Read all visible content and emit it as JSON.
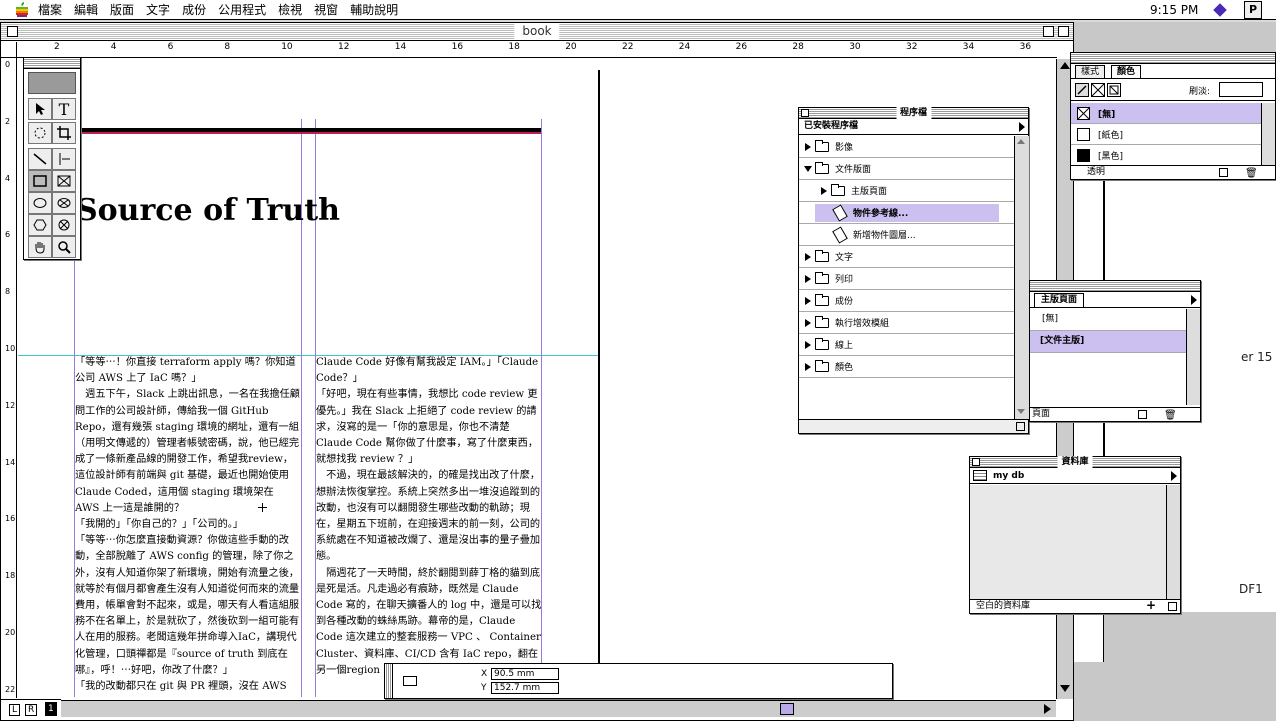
{
  "menubar": {
    "items": [
      "檔案",
      "編輯",
      "版面",
      "文字",
      "成份",
      "公用程式",
      "檢視",
      "視窗",
      "輔助說明"
    ],
    "clock": "9:15 PM"
  },
  "document": {
    "title": "book",
    "ruler_h": [
      "2",
      "4",
      "6",
      "8",
      "10",
      "12",
      "14",
      "16",
      "18",
      "20",
      "22",
      "24",
      "26",
      "28",
      "30",
      "32",
      "34",
      "36"
    ],
    "ruler_v": [
      "0",
      "2",
      "4",
      "6",
      "8",
      "10",
      "12",
      "14",
      "16",
      "18",
      "20",
      "22"
    ],
    "heading": "Source of Truth",
    "col1": "「等等⋯！你直接 terraform apply 嗎？你知道公司 AWS 上了 IaC 嗎？」\n　週五下午，Slack 上跳出訊息，一名在我擔任顧問工作的公司設計師，傳給我一個 GitHub Repo，還有幾張 staging 環境的網址，還有一組（用明文傳遞的）管理者帳號密碼，說，他已經完成了一條新產品線的開發工作，希望我review，這位設計師有前端與 git 基礎，最近也開始使用 Claude Coded，這用個 staging 環境架在 AWS 上一這是誰開的？\n「我開的」「你自己的？」「公司的。」\n「等等⋯你怎麼直接動資源？你做這些手動的改動，全部脫離了 AWS config 的管理，除了你之外，沒有人知道你架了新環境，開始有流量之後，就等於有個月都會產生沒有人知道從何而來的流量費用，帳單會對不起來，或是，哪天有人看這組服務不在名單上，於是就砍了，然後砍到一組可能有人在用的服務。老闆這幾年拼命導入IaC，講現代化管理，口頭禪都是『source of truth 到底在哪』，呼！⋯好吧，你改了什麼？」\n「我的改動都只在 git 與 PR 裡頭，沒在 AWS",
    "col2": "Claude Code 好像有幫我設定 IAM。」「Claude Code？」\n「好吧，現在有些事情，我想比 code review 更優先。」我在 Slack 上拒絕了 code review 的請求，沒寫的是一「你的意思是，你也不清楚Claude Code 幫你做了什麼事，寫了什麼東西，就想找我 review ？」\n　不過，現在最該解決的，的確是找出改了什麼，想辦法恢復掌控。系統上突然多出一堆沒追蹤到的改動，也沒有可以翻閱發生哪些改動的軌跡；現在，星期五下班前，在迎接週末的前一刻，公司的系統處在不知道被改爛了、還是沒出事的量子疊加態。\n　隔週花了一天時間，終於翻閱到薛丁格的貓到底是死是活。凡走過必有痕跡，既然是 Claude Code 寫的，在聊天擴番人的 log 中，還是可以找到各種改動的蛛絲馬跡。幕帝的是，Claude Code 這次建立的整套服務一 VPC 、 Container Cluster、資料庫、CI/CD 含有 IaC repo，翻在另一個region 中，不受影",
    "page_numbers": [
      "L",
      "R",
      "1"
    ],
    "coords": {
      "x_label": "X",
      "x_value": "90.5 mm",
      "y_label": "Y",
      "y_value": "152.7 mm"
    }
  },
  "library_pal": {
    "title": "程序檔",
    "header": "已安裝程序檔",
    "items": [
      {
        "label": "影像",
        "expanded": false
      },
      {
        "label": "文件版面",
        "expanded": true
      },
      {
        "label": "主版頁面",
        "expanded": false,
        "indent": 1
      },
      {
        "label": "物件參考線...",
        "indent": 1,
        "selected": true,
        "script": true
      },
      {
        "label": "新增物件圖層...",
        "indent": 1,
        "script": true
      },
      {
        "label": "文字",
        "expanded": false
      },
      {
        "label": "列印",
        "expanded": false
      },
      {
        "label": "成份",
        "expanded": false
      },
      {
        "label": "執行增效模組",
        "expanded": false
      },
      {
        "label": "線上",
        "expanded": false
      },
      {
        "label": "顏色",
        "expanded": false
      }
    ]
  },
  "colors_pal": {
    "tabs": [
      "樣式",
      "顏色"
    ],
    "tint_label": "刷淡:",
    "swatches": [
      {
        "label": "[無]",
        "selected": true,
        "color": "none"
      },
      {
        "label": "[紙色]",
        "color": "#ffffff"
      },
      {
        "label": "[黑色]",
        "color": "#000000"
      }
    ],
    "footer": "透明"
  },
  "master_pal": {
    "title": "主版頁面",
    "items": [
      {
        "label": "[無]"
      },
      {
        "label": "[文件主版]",
        "selected": true
      }
    ],
    "footer": "頁面"
  },
  "db_pal": {
    "title": "資料庫",
    "item": "my db",
    "footer": "空白的資料庫"
  },
  "background_fragments": [
    "er 15",
    "DF1"
  ]
}
